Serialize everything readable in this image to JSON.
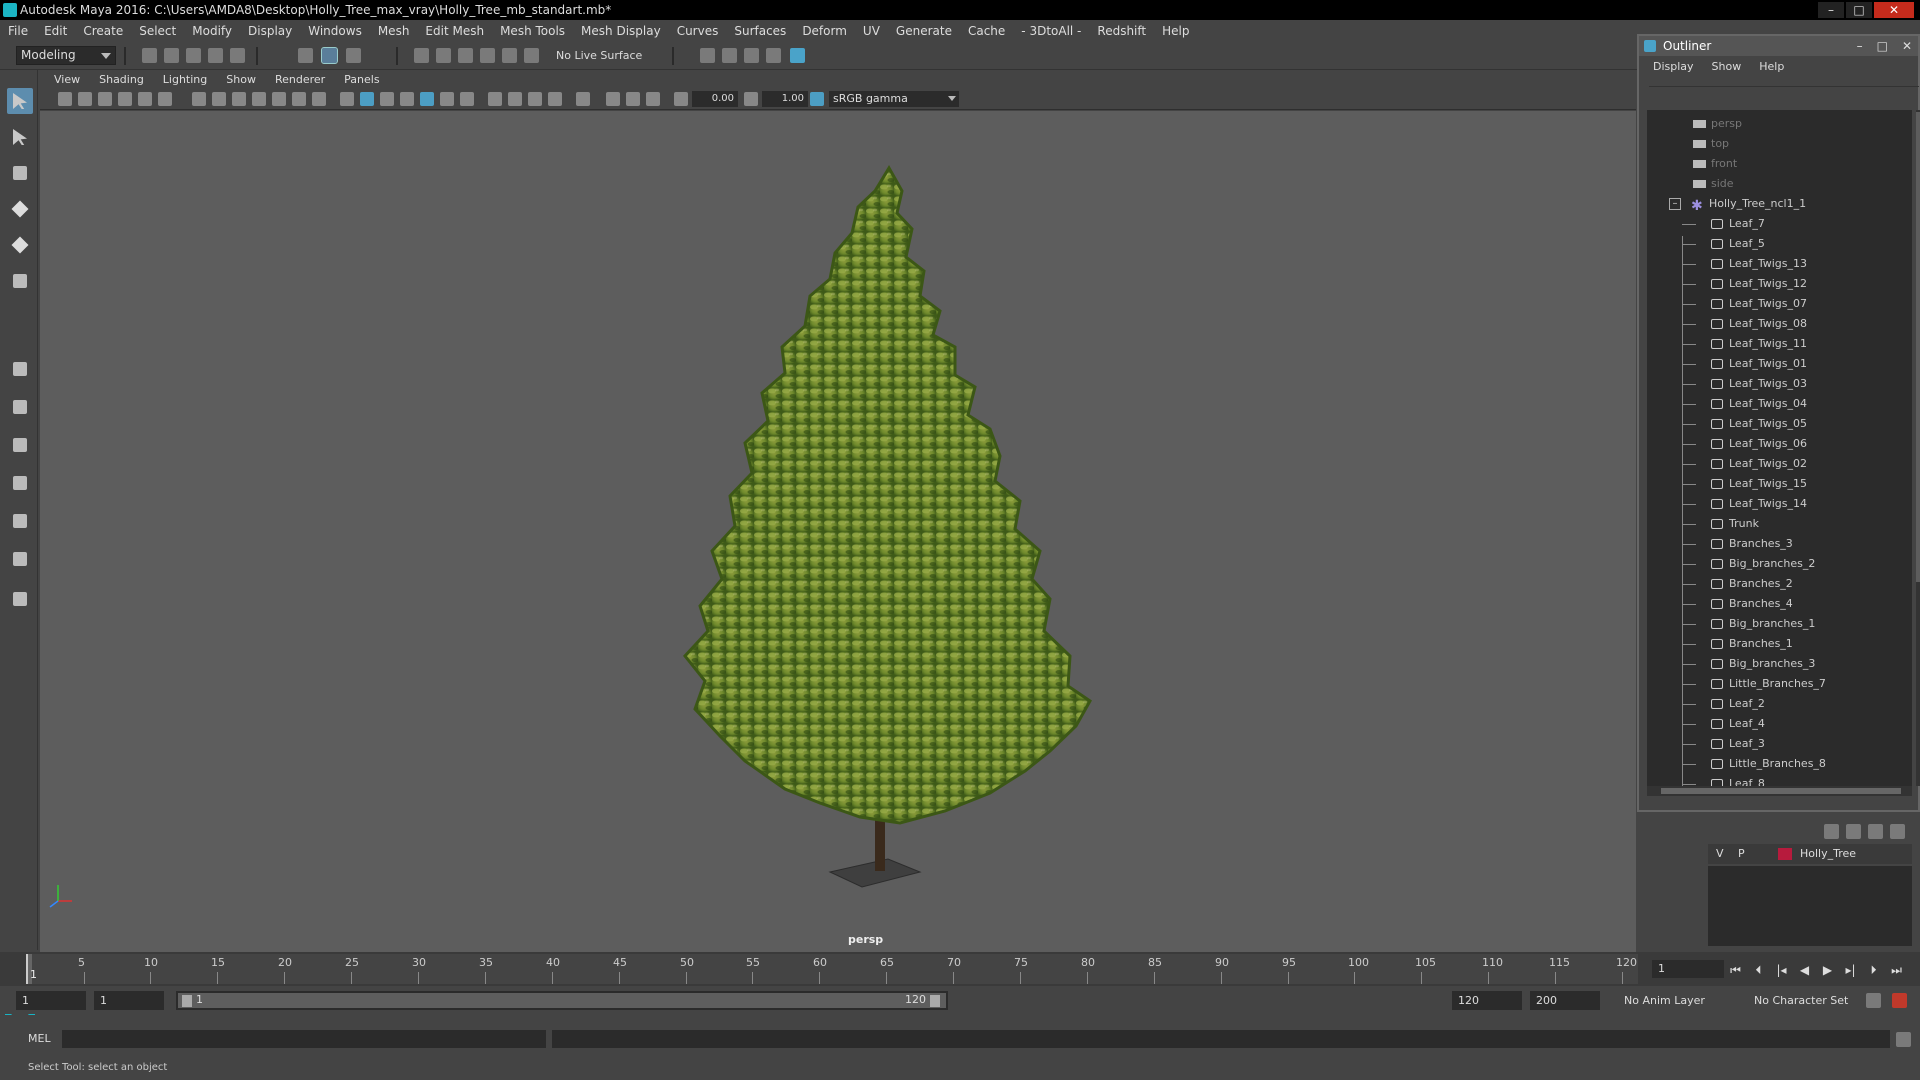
{
  "window": {
    "title": "Autodesk Maya 2016: C:\\Users\\AMDA8\\Desktop\\Holly_Tree_max_vray\\Holly_Tree_mb_standart.mb*",
    "minimize": "–",
    "maximize": "□",
    "close": "✕"
  },
  "menubar": [
    "File",
    "Edit",
    "Create",
    "Select",
    "Modify",
    "Display",
    "Windows",
    "Mesh",
    "Edit Mesh",
    "Mesh Tools",
    "Mesh Display",
    "Curves",
    "Surfaces",
    "Deform",
    "UV",
    "Generate",
    "Cache",
    "- 3DtoAll -",
    "Redshift",
    "Help"
  ],
  "shelf": {
    "mode": "Modeling",
    "live_surface": "No Live Surface"
  },
  "panel": {
    "menu": [
      "View",
      "Shading",
      "Lighting",
      "Show",
      "Renderer",
      "Panels"
    ],
    "field_a": "0.00",
    "field_b": "1.00",
    "color_space": "sRGB gamma",
    "camera": "persp"
  },
  "timeline": {
    "ticks": [
      "5",
      "10",
      "15",
      "20",
      "25",
      "30",
      "35",
      "40",
      "45",
      "50",
      "55",
      "60",
      "65",
      "70",
      "75",
      "80",
      "85",
      "90",
      "95",
      "100",
      "105",
      "110",
      "115",
      "120"
    ],
    "start_marker": "1",
    "current_frame": "1",
    "transport": [
      "⏮",
      "⏴",
      "|◂",
      "◀",
      "▶",
      "▸|",
      "⏵",
      "⏭"
    ]
  },
  "range": {
    "start": "1",
    "anim_start": "1",
    "slider_start": "1",
    "slider_end": "120",
    "anim_end": "120",
    "end": "200",
    "anim_layer": "No Anim Layer",
    "char_set": "No Character Set"
  },
  "command": {
    "mel_label": "MEL"
  },
  "help": {
    "text": "Select Tool: select an object"
  },
  "outliner": {
    "title": "Outliner",
    "controls": [
      "–",
      "□",
      "✕"
    ],
    "menu": [
      "Display",
      "Show",
      "Help"
    ],
    "cameras": [
      "persp",
      "top",
      "front",
      "side"
    ],
    "group": "Holly_Tree_ncl1_1",
    "group_toggle": "–",
    "items": [
      "Leaf_7",
      "Leaf_5",
      "Leaf_Twigs_13",
      "Leaf_Twigs_12",
      "Leaf_Twigs_07",
      "Leaf_Twigs_08",
      "Leaf_Twigs_11",
      "Leaf_Twigs_01",
      "Leaf_Twigs_03",
      "Leaf_Twigs_04",
      "Leaf_Twigs_05",
      "Leaf_Twigs_06",
      "Leaf_Twigs_02",
      "Leaf_Twigs_15",
      "Leaf_Twigs_14",
      "Trunk",
      "Branches_3",
      "Big_branches_2",
      "Branches_2",
      "Branches_4",
      "Big_branches_1",
      "Branches_1",
      "Big_branches_3",
      "Little_Branches_7",
      "Leaf_2",
      "Leaf_4",
      "Leaf_3",
      "Little_Branches_8",
      "Leaf_8"
    ]
  },
  "layers": {
    "v": "V",
    "p": "P",
    "name": "Holly_Tree",
    "color": "#b71b3d"
  }
}
